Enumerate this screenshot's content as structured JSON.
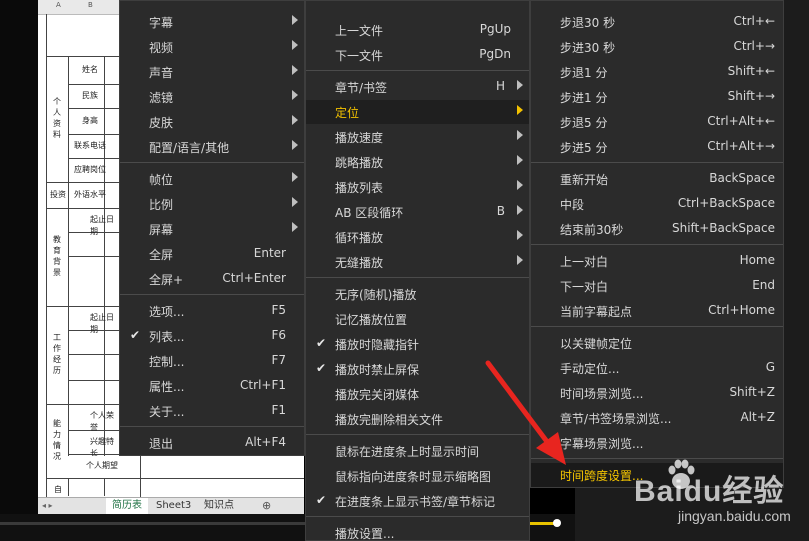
{
  "spreadsheet": {
    "col_headers": [
      "A",
      "B"
    ],
    "left_cells": [
      "姓名",
      "民族",
      "身高",
      "联系电话",
      "应聘岗位",
      "外语水平",
      "起止日期",
      "起止日期"
    ],
    "vertical_groups": [
      "个人资料",
      "教育背景",
      "工作经历",
      "能力情况"
    ],
    "side_labels": [
      "投资",
      "自"
    ],
    "bottom_cells": [
      "个人荣誉",
      "兴趣特长",
      "个人期望"
    ],
    "tabs": [
      "简历表",
      "Sheet3",
      "知识点"
    ],
    "add_tab": "⊕"
  },
  "menu1": {
    "items": [
      {
        "label": "字幕",
        "shortcut": "",
        "arrow": true,
        "check": false
      },
      {
        "label": "视频",
        "shortcut": "",
        "arrow": true,
        "check": false
      },
      {
        "label": "声音",
        "shortcut": "",
        "arrow": true,
        "check": false
      },
      {
        "label": "滤镜",
        "shortcut": "",
        "arrow": true,
        "check": false
      },
      {
        "label": "皮肤",
        "shortcut": "",
        "arrow": true,
        "check": false
      },
      {
        "label": "配置/语言/其他",
        "shortcut": "",
        "arrow": true,
        "check": false
      },
      {
        "label": "帧位",
        "shortcut": "",
        "arrow": true,
        "check": false
      },
      {
        "label": "比例",
        "shortcut": "",
        "arrow": true,
        "check": false
      },
      {
        "label": "屏幕",
        "shortcut": "",
        "arrow": true,
        "check": false
      },
      {
        "label": "全屏",
        "shortcut": "Enter",
        "arrow": false,
        "check": false
      },
      {
        "label": "全屏+",
        "shortcut": "Ctrl+Enter",
        "arrow": false,
        "check": false
      },
      {
        "label": "选项...",
        "shortcut": "F5",
        "arrow": false,
        "check": false
      },
      {
        "label": "列表...",
        "shortcut": "F6",
        "arrow": false,
        "check": true
      },
      {
        "label": "控制...",
        "shortcut": "F7",
        "arrow": false,
        "check": false
      },
      {
        "label": "属性...",
        "shortcut": "Ctrl+F1",
        "arrow": false,
        "check": false
      },
      {
        "label": "关于...",
        "shortcut": "F1",
        "arrow": false,
        "check": false
      },
      {
        "label": "退出",
        "shortcut": "Alt+F4",
        "arrow": false,
        "check": false
      }
    ]
  },
  "menu2": {
    "items": [
      {
        "label": "上一文件",
        "shortcut": "PgUp",
        "arrow": false,
        "check": false
      },
      {
        "label": "下一文件",
        "shortcut": "PgDn",
        "arrow": false,
        "check": false
      },
      {
        "label": "章节/书签",
        "shortcut": "H",
        "arrow": true,
        "check": false
      },
      {
        "label": "定位",
        "shortcut": "",
        "arrow": true,
        "check": false
      },
      {
        "label": "播放速度",
        "shortcut": "",
        "arrow": true,
        "check": false
      },
      {
        "label": "跳略播放",
        "shortcut": "",
        "arrow": true,
        "check": false
      },
      {
        "label": "播放列表",
        "shortcut": "",
        "arrow": true,
        "check": false
      },
      {
        "label": "AB 区段循环",
        "shortcut": "B",
        "arrow": true,
        "check": false
      },
      {
        "label": "循环播放",
        "shortcut": "",
        "arrow": true,
        "check": false
      },
      {
        "label": "无缝播放",
        "shortcut": "",
        "arrow": true,
        "check": false
      },
      {
        "label": "无序(随机)播放",
        "shortcut": "",
        "arrow": false,
        "check": false
      },
      {
        "label": "记忆播放位置",
        "shortcut": "",
        "arrow": false,
        "check": false
      },
      {
        "label": "播放时隐藏指针",
        "shortcut": "",
        "arrow": false,
        "check": true
      },
      {
        "label": "播放时禁止屏保",
        "shortcut": "",
        "arrow": false,
        "check": true
      },
      {
        "label": "播放完关闭媒体",
        "shortcut": "",
        "arrow": false,
        "check": false
      },
      {
        "label": "播放完删除相关文件",
        "shortcut": "",
        "arrow": false,
        "check": false
      },
      {
        "label": "鼠标在进度条上时显示时间",
        "shortcut": "",
        "arrow": false,
        "check": false
      },
      {
        "label": "鼠标指向进度条时显示缩略图",
        "shortcut": "",
        "arrow": false,
        "check": false
      },
      {
        "label": "在进度条上显示书签/章节标记",
        "shortcut": "",
        "arrow": false,
        "check": true
      },
      {
        "label": "播放设置...",
        "shortcut": "",
        "arrow": false,
        "check": false
      }
    ]
  },
  "menu3": {
    "items": [
      {
        "label": "步退30 秒",
        "shortcut": "Ctrl+←"
      },
      {
        "label": "步进30 秒",
        "shortcut": "Ctrl+→"
      },
      {
        "label": "步退1 分",
        "shortcut": "Shift+←"
      },
      {
        "label": "步进1 分",
        "shortcut": "Shift+→"
      },
      {
        "label": "步退5 分",
        "shortcut": "Ctrl+Alt+←"
      },
      {
        "label": "步进5 分",
        "shortcut": "Ctrl+Alt+→"
      },
      {
        "label": "重新开始",
        "shortcut": "BackSpace"
      },
      {
        "label": "中段",
        "shortcut": "Ctrl+BackSpace"
      },
      {
        "label": "结束前30秒",
        "shortcut": "Shift+BackSpace"
      },
      {
        "label": "上一对白",
        "shortcut": "Home"
      },
      {
        "label": "下一对白",
        "shortcut": "End"
      },
      {
        "label": "当前字幕起点",
        "shortcut": "Ctrl+Home"
      },
      {
        "label": "以关键帧定位",
        "shortcut": ""
      },
      {
        "label": "手动定位...",
        "shortcut": "G"
      },
      {
        "label": "时间场景浏览...",
        "shortcut": "Shift+Z"
      },
      {
        "label": "章节/书签场景浏览...",
        "shortcut": "Alt+Z"
      },
      {
        "label": "字幕场景浏览...",
        "shortcut": ""
      },
      {
        "label": "时间跨度设置...",
        "shortcut": ""
      }
    ]
  },
  "watermark": {
    "brand": "Baidu经验",
    "url": "jingyan.baidu.com"
  },
  "colors": {
    "menu_bg": "#2b2b2b",
    "highlight_text": "#f2c100",
    "arrow": "#e8251f"
  }
}
